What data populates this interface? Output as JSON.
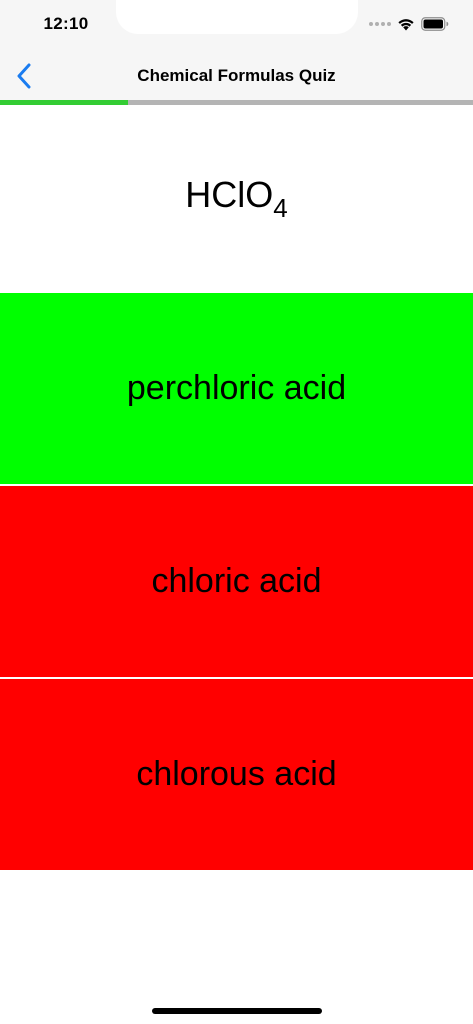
{
  "status_bar": {
    "time": "12:10",
    "icons": [
      "cellular-dots-icon",
      "wifi-icon",
      "battery-icon"
    ]
  },
  "nav": {
    "title": "Chemical Formulas Quiz",
    "back_icon": "chevron-left-icon",
    "accent_color": "#1a7cf0"
  },
  "progress": {
    "fraction": 0.27,
    "fill_color": "#33cc33",
    "track_color": "#b4b4b4"
  },
  "question": {
    "formula_base": "HClO",
    "formula_subscript": "4"
  },
  "answers": [
    {
      "label": "perchloric acid",
      "state": "correct",
      "color": "#00ff00"
    },
    {
      "label": "chloric acid",
      "state": "incorrect",
      "color": "#ff0000"
    },
    {
      "label": "chlorous acid",
      "state": "incorrect",
      "color": "#ff0000"
    }
  ]
}
